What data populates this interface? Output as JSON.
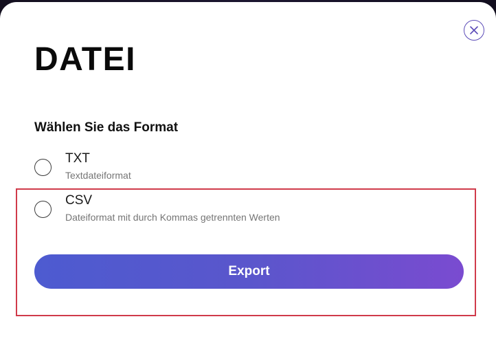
{
  "dialog": {
    "title": "DATEI",
    "close_icon": "close-icon",
    "section_label": "Wählen Sie das Format",
    "options": [
      {
        "name": "TXT",
        "description": "Textdateiformat",
        "selected": false
      },
      {
        "name": "CSV",
        "description": "Dateiformat mit durch Kommas getrennten Werten",
        "selected": false
      }
    ],
    "export_label": "Export"
  },
  "colors": {
    "accent_start": "#4d5bd0",
    "accent_end": "#7a4bd0",
    "close_border": "#5b4bb8",
    "highlight": "#d03a4a"
  }
}
